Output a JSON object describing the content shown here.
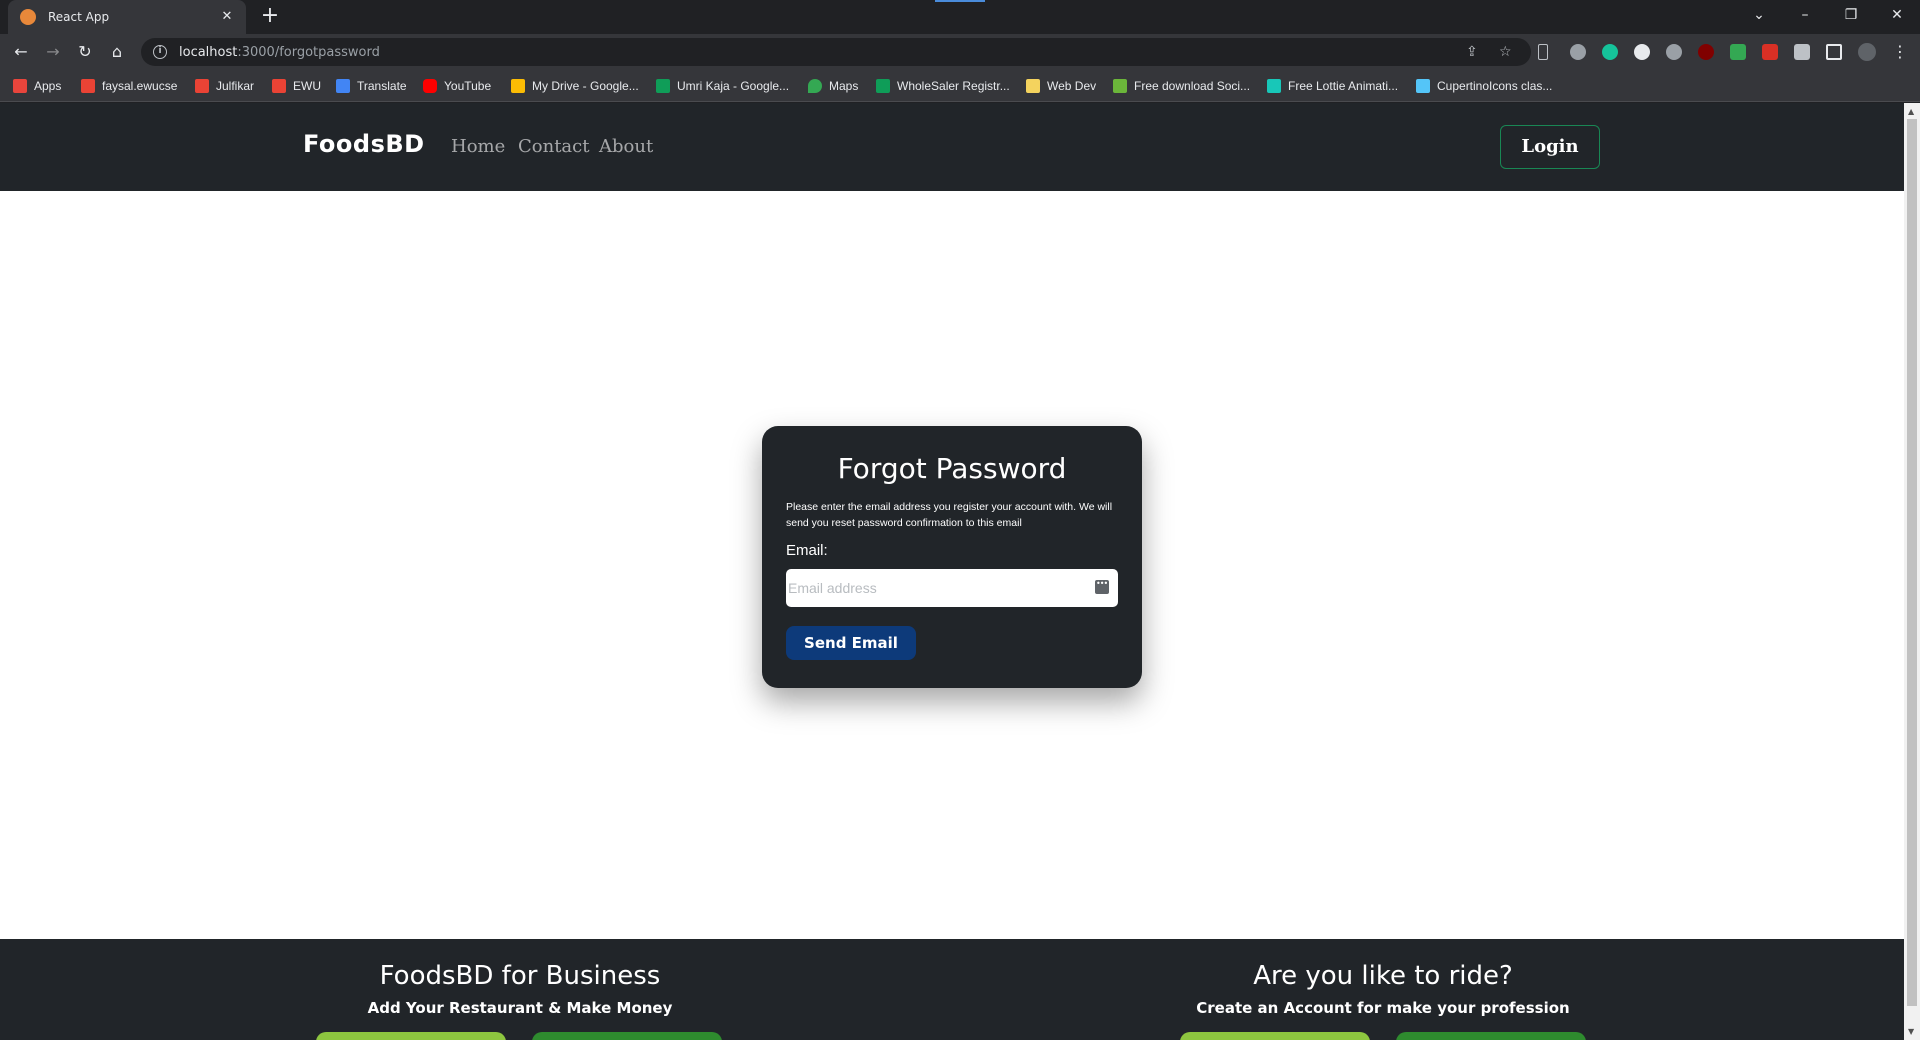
{
  "browser": {
    "tab_title": "React App",
    "tab_close": "✕",
    "new_tab": "+",
    "url_host": "localhost",
    "url_path": ":3000/forgotpassword",
    "window_controls": {
      "tabsearch": "⌄",
      "minimize": "–",
      "restore": "❐",
      "close": "✕"
    },
    "nav": {
      "back": "←",
      "forward": "→",
      "reload": "↻",
      "home": "⌂"
    },
    "bookmarks": [
      {
        "label": "Apps",
        "color": "#e8453c"
      },
      {
        "label": "faysal.ewucse",
        "color": "#ea4335"
      },
      {
        "label": "Julfikar",
        "color": "#ea4335"
      },
      {
        "label": "EWU",
        "color": "#ea4335"
      },
      {
        "label": "Translate",
        "color": "#4285f4"
      },
      {
        "label": "YouTube",
        "color": "#ff0000"
      },
      {
        "label": "My Drive - Google...",
        "color": "#fbbc04"
      },
      {
        "label": "Umri Kaja - Google...",
        "color": "#0f9d58"
      },
      {
        "label": "Maps",
        "color": "#34a853"
      },
      {
        "label": "WholeSaler Registr...",
        "color": "#0f9d58"
      },
      {
        "label": "Web Dev",
        "color": "#f4d35e"
      },
      {
        "label": "Free download Soci...",
        "color": "#6bb63a"
      },
      {
        "label": "Free Lottie Animati...",
        "color": "#18c7b8"
      },
      {
        "label": "CupertinoIcons clas...",
        "color": "#54c5f8"
      }
    ]
  },
  "site": {
    "brand": "FoodsBD",
    "nav_links": [
      "Home",
      "Contact",
      "About"
    ],
    "login_label": "Login"
  },
  "forgot": {
    "title": "Forgot Password",
    "description": "Please enter the email address you register your account with. We will send you reset password confirmation to this email",
    "email_label": "Email:",
    "email_placeholder": "Email address",
    "email_value": "",
    "send_label": "Send Email"
  },
  "footer": {
    "left_title": "FoodsBD for Business",
    "left_sub": "Add Your Restaurant & Make Money",
    "right_title": "Are you like to ride?",
    "right_sub": "Create an Account for make your profession"
  },
  "colors": {
    "navbar": "#212529",
    "login_border": "#198754",
    "send_button": "#0d3a7a",
    "footer_btn_light": "#8dc63f",
    "footer_btn_dark": "#2e8b2e"
  }
}
